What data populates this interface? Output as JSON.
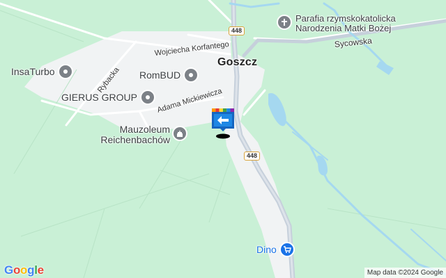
{
  "map": {
    "town": "Goszcz",
    "road_number": "448",
    "streets": {
      "korfantego": "Wojciecha Korfantego",
      "rybacka": "Rybacka",
      "mickiewicza": "Adama Mickiewicza",
      "sycowska": "Sycowska"
    },
    "pois": {
      "insaturbo": "InsaTurbo",
      "rombud": "RomBUD",
      "gierus": "GIERUS GROUP",
      "mauzoleum_line1": "Mauzoleum",
      "mauzoleum_line2": "Reichenbachów",
      "parafia_line1": "Parafia rzymskokatolicka",
      "parafia_line2": "Narodzenia Matki Bożej",
      "dino": "Dino"
    },
    "logo": {
      "letters": [
        "G",
        "o",
        "o",
        "g",
        "l",
        "e"
      ],
      "colors": [
        "#4285F4",
        "#EA4335",
        "#FBBC05",
        "#4285F4",
        "#34A853",
        "#EA4335"
      ]
    },
    "attribution": "Map data ©2024 Google",
    "colors": {
      "land": "#c9f0d6",
      "urban": "#f1f3f4",
      "water": "#a5d8f0",
      "main_road": "#c6d0db",
      "poi_grey": "#7c8187",
      "shop_blue": "#1a73e8"
    }
  }
}
